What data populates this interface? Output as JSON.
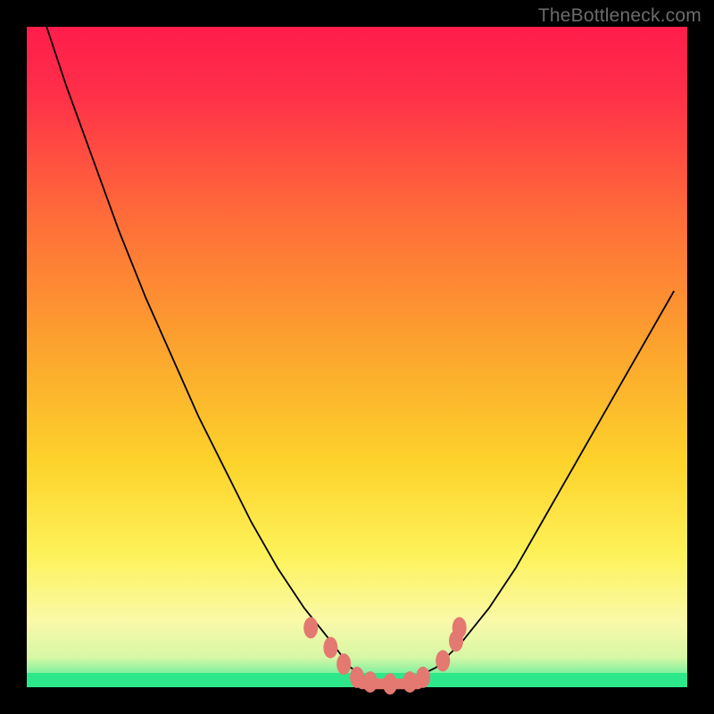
{
  "watermark": "TheBottleneck.com",
  "colors": {
    "frame_border": "#000000",
    "gradient_top": "#ff1d4b",
    "gradient_mid1": "#ff6a3a",
    "gradient_mid2": "#fdd32b",
    "gradient_low": "#f9f99b",
    "gradient_green": "#2de88a",
    "curve": "#000000",
    "markers": "#e37971"
  },
  "chart_data": {
    "type": "line",
    "title": "",
    "xlabel": "",
    "ylabel": "",
    "xlim": [
      0,
      100
    ],
    "ylim": [
      0,
      100
    ],
    "x": [
      3,
      6,
      10,
      14,
      18,
      22,
      26,
      30,
      34,
      38,
      42,
      46,
      49,
      52,
      55,
      58,
      62,
      66,
      70,
      74,
      78,
      82,
      86,
      90,
      94,
      98
    ],
    "values": [
      100,
      91,
      80,
      69,
      59,
      50,
      41,
      33,
      25,
      18,
      12,
      7,
      3,
      1,
      0.5,
      1,
      3,
      7,
      12,
      18,
      25,
      32,
      39,
      46,
      53,
      60
    ],
    "markers": [
      {
        "x": 43,
        "y": 9
      },
      {
        "x": 46,
        "y": 6
      },
      {
        "x": 48,
        "y": 3.5
      },
      {
        "x": 50,
        "y": 1.5
      },
      {
        "x": 52,
        "y": 0.8
      },
      {
        "x": 55,
        "y": 0.5
      },
      {
        "x": 58,
        "y": 0.8
      },
      {
        "x": 60,
        "y": 1.5
      },
      {
        "x": 63,
        "y": 4
      },
      {
        "x": 65,
        "y": 7
      },
      {
        "x": 65.5,
        "y": 9
      }
    ],
    "annotations": []
  }
}
